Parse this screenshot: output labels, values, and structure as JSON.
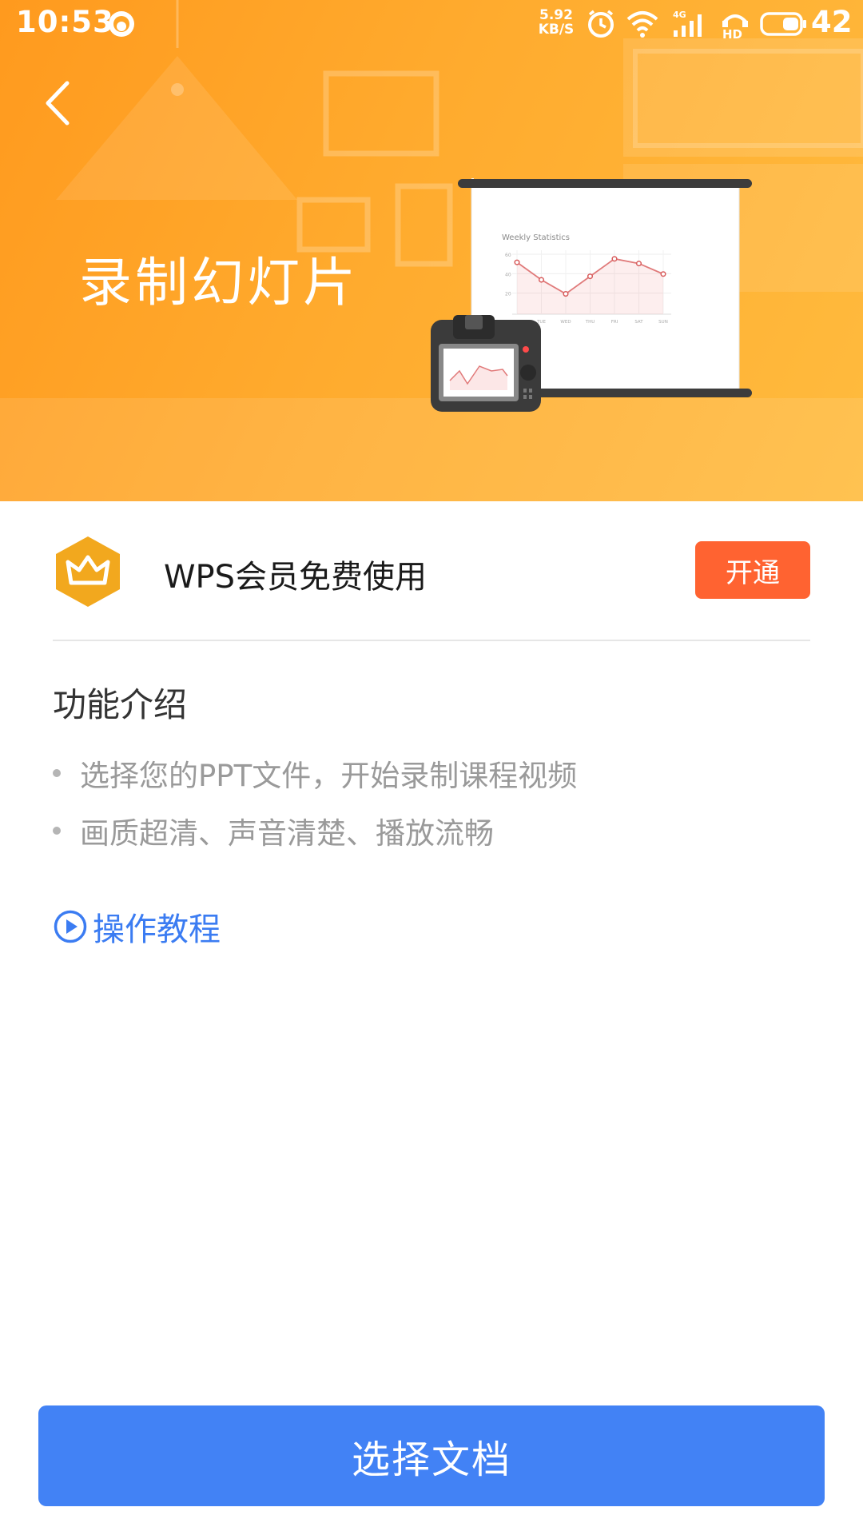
{
  "status_bar": {
    "time": "10:53",
    "net_speed_value": "5.92",
    "net_speed_unit": "KB/S",
    "network_type": "4G",
    "hd_label": "HD",
    "battery": "42"
  },
  "hero": {
    "title": "录制幻灯片",
    "slide_chart_title": "Weekly Statistics",
    "slide_chart_days": [
      "MON",
      "TUE",
      "WED",
      "THU",
      "FRI",
      "SAT",
      "SUN"
    ],
    "slide_chart_yticks": [
      "60",
      "40",
      "20"
    ]
  },
  "vip": {
    "text": "WPS会员免费使用",
    "button": "开通"
  },
  "features": {
    "heading": "功能介绍",
    "items": [
      "选择您的PPT文件，开始录制课程视频",
      "画质超清、声音清楚、播放流畅"
    ],
    "tutorial": "操作教程"
  },
  "footer": {
    "select_button": "选择文档"
  },
  "colors": {
    "hero_orange": "#ffa526",
    "vip_button": "#ff6331",
    "crown_gold": "#f2a81e",
    "link_blue": "#3b7cf2",
    "primary_button": "#4282f5"
  }
}
